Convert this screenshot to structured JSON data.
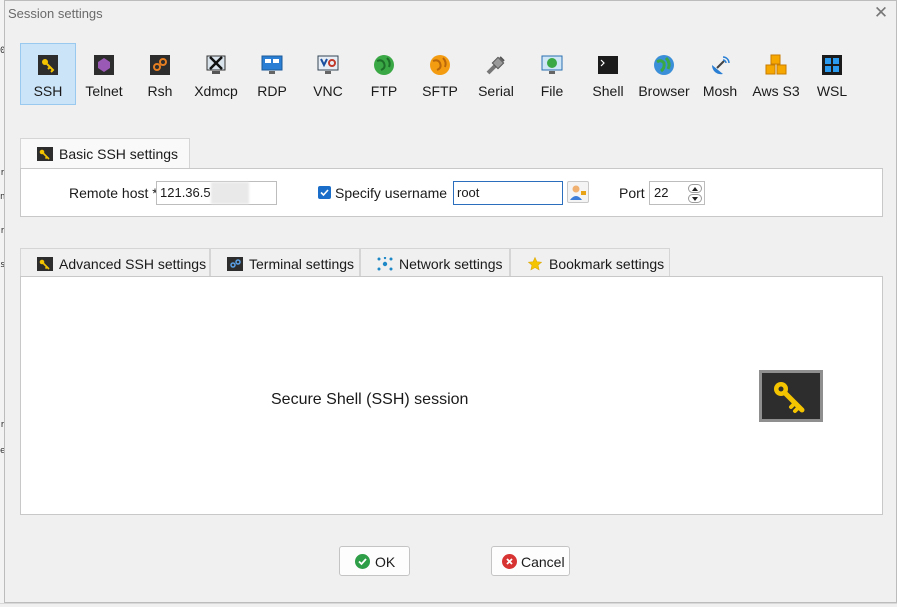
{
  "window": {
    "title": "Session settings"
  },
  "background_glyphs": [
    "0",
    "r",
    "n",
    "r",
    "s",
    "r",
    "e"
  ],
  "protocols": [
    {
      "label": "SSH",
      "icon": "ssh-key-icon",
      "active": true
    },
    {
      "label": "Telnet",
      "icon": "telnet-icon",
      "active": false
    },
    {
      "label": "Rsh",
      "icon": "rsh-icon",
      "active": false
    },
    {
      "label": "Xdmcp",
      "icon": "xdmcp-icon",
      "active": false
    },
    {
      "label": "RDP",
      "icon": "rdp-monitor-icon",
      "active": false
    },
    {
      "label": "VNC",
      "icon": "vnc-monitor-icon",
      "active": false
    },
    {
      "label": "FTP",
      "icon": "ftp-globe-icon",
      "active": false
    },
    {
      "label": "SFTP",
      "icon": "sftp-globe-icon",
      "active": false
    },
    {
      "label": "Serial",
      "icon": "serial-plug-icon",
      "active": false
    },
    {
      "label": "File",
      "icon": "file-monitor-icon",
      "active": false
    },
    {
      "label": "Shell",
      "icon": "shell-terminal-icon",
      "active": false
    },
    {
      "label": "Browser",
      "icon": "browser-globe-icon",
      "active": false
    },
    {
      "label": "Mosh",
      "icon": "mosh-satellite-icon",
      "active": false
    },
    {
      "label": "Aws S3",
      "icon": "aws-s3-cubes-icon",
      "active": false
    },
    {
      "label": "WSL",
      "icon": "wsl-windows-icon",
      "active": false
    }
  ],
  "basic_tab": {
    "label": "Basic SSH settings"
  },
  "basic": {
    "remote_host_label": "Remote host *",
    "remote_host_value": "121.36.5",
    "specify_username_label": "Specify username",
    "specify_username_checked": true,
    "username_value": "root",
    "port_label": "Port",
    "port_value": "22"
  },
  "lower_tabs": [
    {
      "label": "Advanced SSH settings",
      "icon": "ssh-key-icon"
    },
    {
      "label": "Terminal settings",
      "icon": "terminal-icon"
    },
    {
      "label": "Network settings",
      "icon": "network-icon"
    },
    {
      "label": "Bookmark settings",
      "icon": "star-icon"
    }
  ],
  "main": {
    "description": "Secure Shell (SSH) session"
  },
  "buttons": {
    "ok": "OK",
    "cancel": "Cancel"
  },
  "colors": {
    "active_tool_bg": "#cce4f7",
    "ok_green": "#2f9e48",
    "cancel_red": "#d83333",
    "key_yellow": "#f5c400"
  }
}
